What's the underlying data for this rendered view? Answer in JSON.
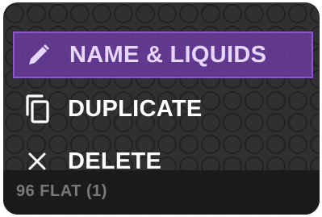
{
  "menu": {
    "items": [
      {
        "label": "NAME & LIQUIDS",
        "icon": "pencil-icon",
        "selected": true
      },
      {
        "label": "DUPLICATE",
        "icon": "duplicate-icon",
        "selected": false
      },
      {
        "label": "DELETE",
        "icon": "close-icon",
        "selected": false
      }
    ]
  },
  "footer": {
    "labware_label": "96 FLAT (1)"
  },
  "colors": {
    "card_background": "#3b3b3d",
    "selected_fill": "#703eaa",
    "selected_border": "#8f52d4",
    "well_outline": "#1c1c1e",
    "footer_text": "#7a7a7d"
  }
}
